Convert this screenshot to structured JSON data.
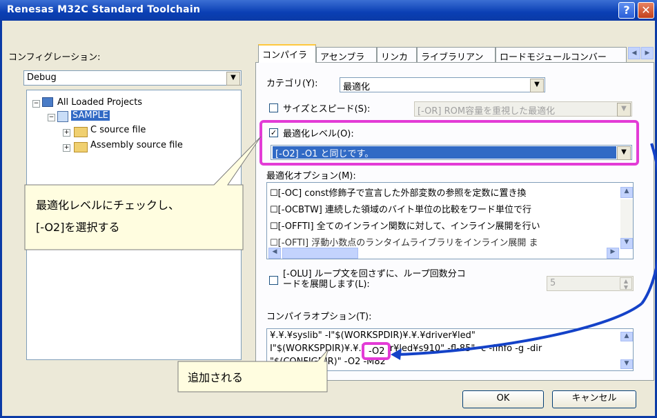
{
  "window": {
    "title": "Renesas M32C Standard Toolchain",
    "help_label": "?",
    "close_label": "✕"
  },
  "config": {
    "label": "コンフィグレーション:",
    "value": "Debug"
  },
  "tree": {
    "root": "All Loaded Projects",
    "project": "SAMPLE",
    "children": [
      "C source file",
      "Assembly source file"
    ]
  },
  "tabs": [
    "コンパイラ",
    "アセンブラ",
    "リンカ",
    "ライブラリアン",
    "ロードモジュールコンバー"
  ],
  "category": {
    "label": "カテゴリ(Y):",
    "value": "最適化"
  },
  "size_speed": {
    "label": "サイズとスピード(S):",
    "value": "[-OR] ROM容量を重視した最適化",
    "checked": false
  },
  "opt_level": {
    "label": "最適化レベル(O):",
    "value": "[-O2] -O1 と同じです。",
    "checked": true
  },
  "opt_options": {
    "label": "最適化オプション(M):",
    "items": [
      "[-OC] const修飾子で宣言した外部変数の参照を定数に置き換",
      "[-OCBTW] 連続した領域のバイト単位の比較をワード単位で行",
      "[-OFFTI] 全てのインライン関数に対して、インライン展開を行い",
      "[-OFTI] 浮動小数点のランタイムライブラリをインライン展開 ま"
    ]
  },
  "loop": {
    "label_line1": "[-OLU] ループ文を回さずに、ループ回数分コ",
    "label_line2": "ードを展開します(L):",
    "value": "5",
    "checked": false
  },
  "compiler_options": {
    "label": "コンパイラオプション(T):",
    "lines": [
      "¥.¥.¥syslib\" -I\"$(WORKSPDIR)¥.¥.¥driver¥led\"",
      "I\"$(WORKSPDIR)¥.¥.¥driver¥led¥s910\" -fl-85\" -c -finfo -g -dir",
      "\"$(CONFIGDIR)\" -O2 -M82"
    ],
    "highlight": "-O2"
  },
  "buttons": {
    "ok": "OK",
    "cancel": "キャンセル"
  },
  "callouts": {
    "one_line1": "最適化レベルにチェックし、",
    "one_line2": "[-O2]を選択する",
    "two": "追加される"
  },
  "colors": {
    "highlight": "#e33bd6",
    "arrow": "#1442c8",
    "selection": "#316ac5"
  }
}
